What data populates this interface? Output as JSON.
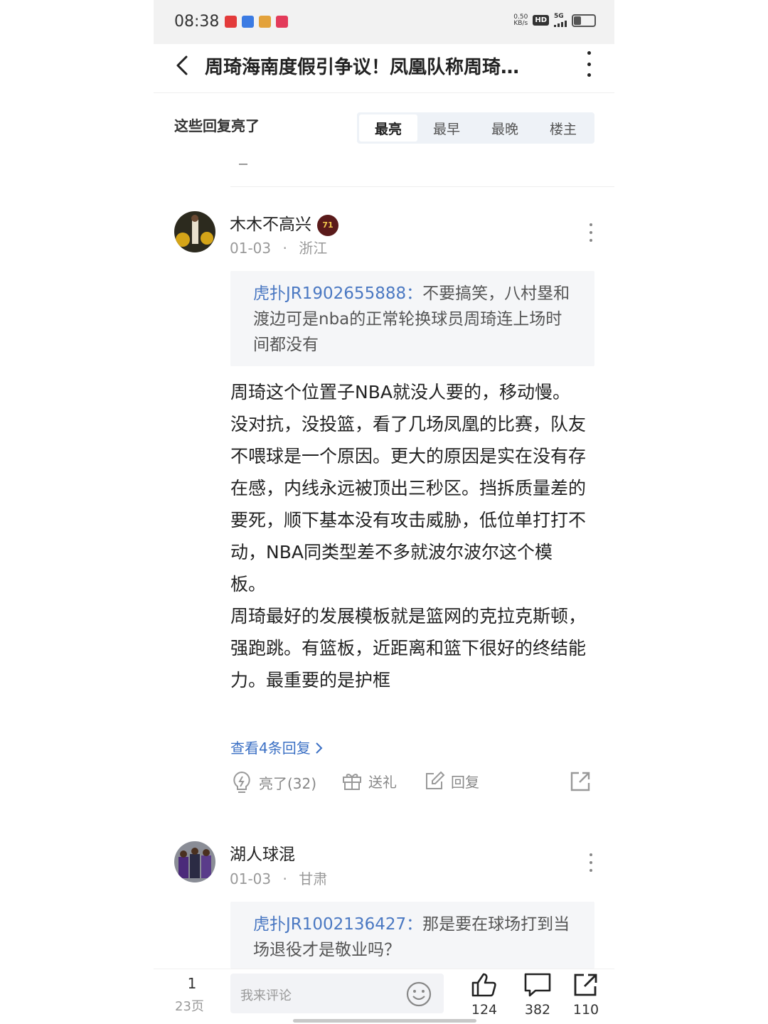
{
  "status_bar": {
    "time": "08:38",
    "net_speed_value": "0.50",
    "net_speed_unit": "KB/s",
    "hd_label": "HD",
    "network": "5G",
    "app_icon_colors": [
      "#e33b3b",
      "#3b7be3",
      "#e3a23b",
      "#e33b5a"
    ]
  },
  "header": {
    "title": "周琦海南度假引争议！凤凰队称周琦…"
  },
  "sort": {
    "label": "这些回复亮了",
    "tabs": [
      "最亮",
      "最早",
      "最晚",
      "楼主"
    ],
    "active_index": 0
  },
  "comments": [
    {
      "username": "木木不高兴",
      "badge": "71",
      "date": "01-03",
      "separator": "·",
      "location": "浙江",
      "quote_name": "虎扑JR1902655888：",
      "quote_text": "不要搞笑，八村塁和渡边可是nba的正常轮换球员周琦连上场时间都没有",
      "body_lines": [
        "周琦这个位置子NBA就没人要的，移动慢。没对抗，没投篮，看了几场凤凰的比赛，队友不喂球是一个原因。更大的原因是实在没有存在感，内线永远被顶出三秒区。挡拆质量差的要死，顺下基本没有攻击威胁，低位单打打不动，NBA同类型差不多就波尔波尔这个模板。",
        "周琦最好的发展模板就是篮网的克拉克斯顿，强跑跳。有篮板，近距离和篮下很好的终结能力。最重要的是护框"
      ],
      "view_replies": "查看4条回复 ",
      "like_label": "亮了(32)",
      "gift_label": "送礼",
      "reply_label": "回复"
    },
    {
      "username": "湖人球混",
      "date": "01-03",
      "separator": "·",
      "location": "甘肃",
      "quote_name": "虎扑JR1002136427：",
      "quote_text": "那是要在球场打到当场退役才是敬业吗？"
    }
  ],
  "bottom_bar": {
    "page_current": "1",
    "page_total": "23页",
    "comment_placeholder": "我来评论",
    "like_count": "124",
    "comment_count": "382",
    "share_count": "110"
  },
  "colors": {
    "accent_blue": "#3a6fc4",
    "quote_bg": "#f5f6f8",
    "sort_bg": "#eef2f7"
  }
}
